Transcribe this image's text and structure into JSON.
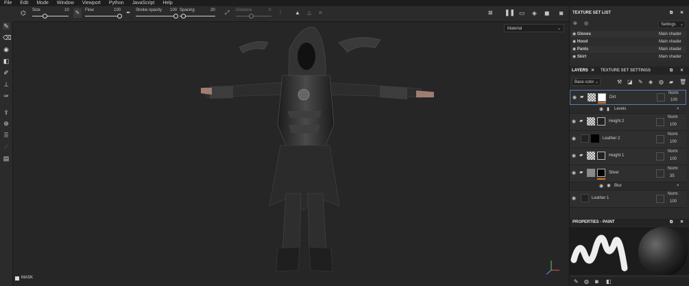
{
  "menu": [
    "File",
    "Edit",
    "Mode",
    "Window",
    "Viewport",
    "Python",
    "JavaScript",
    "Help"
  ],
  "toolbar": {
    "size_label": "Size",
    "size_value": "10",
    "flow_label": "Flow",
    "flow_value": "100",
    "stroke_label": "Stroke opacity",
    "stroke_value": "100",
    "spacing_label": "Spacing",
    "spacing_value": "20",
    "distance_label": "Distance",
    "distance_value": "0"
  },
  "viewport": {
    "material_select": "Material",
    "mask_label": "MASK"
  },
  "texture_set_list": {
    "title": "TEXTURE SET LIST",
    "settings_label": "Settings",
    "items": [
      {
        "name": "Gloves",
        "shader": "Main shader"
      },
      {
        "name": "Hood",
        "shader": "Main shader"
      },
      {
        "name": "Pants",
        "shader": "Main shader"
      },
      {
        "name": "Skirt",
        "shader": "Main shader"
      }
    ]
  },
  "layers_panel": {
    "tab_layers": "LAYERS",
    "tab_settings": "TEXTURE SET SETTINGS",
    "channel": "Base color",
    "layers": [
      {
        "name": "Dirt",
        "blend": "Norm",
        "opacity": "100"
      },
      {
        "name": "Levels",
        "effect": true
      },
      {
        "name": "Height 2",
        "blend": "Norm",
        "opacity": "100"
      },
      {
        "name": "Leather 2",
        "blend": "Norm",
        "opacity": "100"
      },
      {
        "name": "Height 1",
        "blend": "Norm",
        "opacity": "100"
      },
      {
        "name": "Silver",
        "blend": "Norm",
        "opacity": "35"
      },
      {
        "name": "Blur",
        "effect": true
      },
      {
        "name": "Leather 1",
        "blend": "Norm",
        "opacity": "100"
      }
    ]
  },
  "properties": {
    "title": "PROPERTIES - PAINT"
  },
  "colors": {
    "accent": "#e07b1e",
    "panel": "#2b2b2b",
    "viewport": "#262626"
  }
}
